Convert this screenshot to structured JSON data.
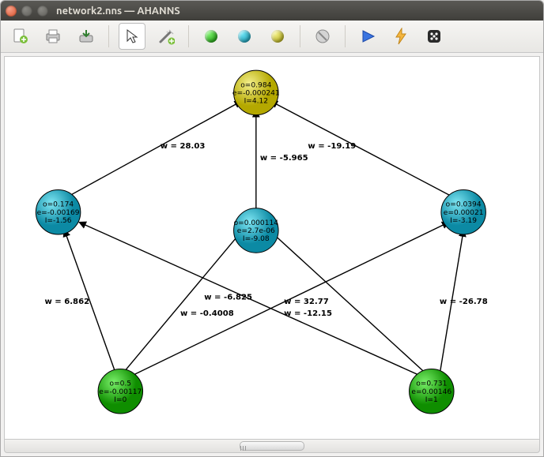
{
  "window": {
    "title": "network2.nns — AHANNS"
  },
  "toolbar": {
    "new": {
      "icon": "file-new-icon"
    },
    "print": {
      "icon": "print-icon"
    },
    "open": {
      "icon": "open-icon"
    },
    "cursor": {
      "icon": "cursor-icon",
      "selected": true
    },
    "wand": {
      "icon": "wand-add-icon"
    },
    "node_green": {
      "icon": "add-input-node-icon"
    },
    "node_cyan": {
      "icon": "add-hidden-node-icon"
    },
    "node_yellow": {
      "icon": "add-output-node-icon"
    },
    "disable": {
      "icon": "disable-icon"
    },
    "run": {
      "icon": "run-icon"
    },
    "bolt": {
      "icon": "train-icon"
    },
    "dice": {
      "icon": "randomize-icon"
    }
  },
  "nodes": {
    "out": {
      "l1": "o=0.984",
      "l2": "e=-0.000241",
      "l3": "I=4.12"
    },
    "h1": {
      "l1": "o=0.174",
      "l2": "e=-0.00169",
      "l3": "I=-1.56"
    },
    "h2": {
      "l1": "o=0.000114",
      "l2": "e=2.7e-06",
      "l3": "I=-9.08"
    },
    "h3": {
      "l1": "o=0.0394",
      "l2": "e=0.00021",
      "l3": "I=-3.19"
    },
    "in1": {
      "l1": "o=0.5",
      "l2": "e=-0.00117",
      "l3": "I=0"
    },
    "in2": {
      "l1": "o=0.731",
      "l2": "e=0.00146",
      "l3": "I=1"
    }
  },
  "edges": {
    "h1_out": {
      "label": "w = 28.03"
    },
    "h2_out": {
      "label": "w = -5.965"
    },
    "h3_out": {
      "label": "w = -19.19"
    },
    "in1_h1": {
      "label": "w = 6.862"
    },
    "in1_h2": {
      "label": "w = -0.4008"
    },
    "in1_h3": {
      "label": "w = 32.77"
    },
    "in2_h1": {
      "label": "w = -6.825"
    },
    "in2_h2": {
      "label": "w = -12.15"
    },
    "in2_h3": {
      "label": "w = -26.78"
    }
  }
}
